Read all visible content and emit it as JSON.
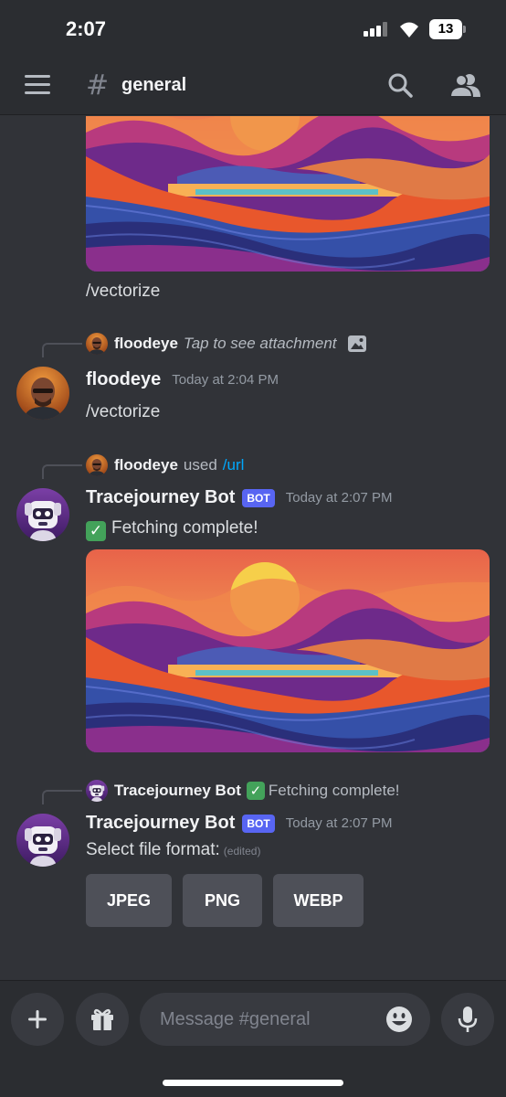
{
  "status_bar": {
    "time": "2:07",
    "battery": "13"
  },
  "header": {
    "channel": "general",
    "icons": [
      "menu-icon",
      "hash-icon",
      "search-icon",
      "members-icon"
    ]
  },
  "messages": {
    "first": {
      "text": "/vectorize"
    },
    "floodeye_msg": {
      "reply_user": "floodeye",
      "reply_text": "Tap to see attachment",
      "author": "floodeye",
      "timestamp": "Today at 2:04 PM",
      "text": "/vectorize"
    },
    "bot_fetch": {
      "reply_user": "floodeye",
      "reply_used": "used",
      "reply_command": "/url",
      "author": "Tracejourney Bot",
      "badge": "BOT",
      "timestamp": "Today at 2:07 PM",
      "text": "Fetching complete!"
    },
    "bot_format": {
      "reply_user": "Tracejourney Bot",
      "reply_text": "Fetching complete!",
      "author": "Tracejourney Bot",
      "badge": "BOT",
      "timestamp": "Today at 2:07 PM",
      "text": "Select file format:",
      "edited": "(edited)",
      "buttons": [
        "JPEG",
        "PNG",
        "WEBP"
      ]
    }
  },
  "composer": {
    "placeholder": "Message #general",
    "icons": [
      "plus-icon",
      "gift-icon",
      "emoji-icon",
      "microphone-icon"
    ]
  },
  "colors": {
    "background": "#313338",
    "header": "#2b2d31",
    "link": "#00a8fc",
    "bot_badge": "#5865f2",
    "button": "#4e5058"
  }
}
